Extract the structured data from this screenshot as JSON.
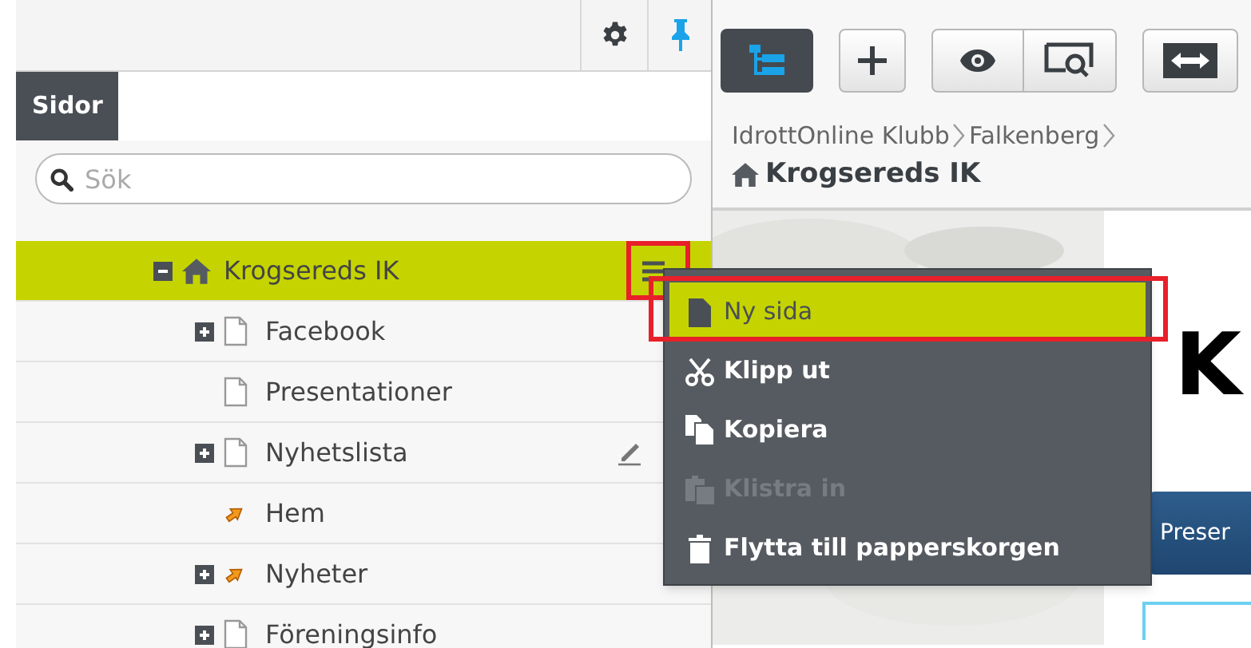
{
  "panel_tab": {
    "label": "Sidor",
    "selected": true
  },
  "search": {
    "placeholder": "Sök"
  },
  "tree": [
    {
      "label": "Krogsereds IK",
      "kind": "home",
      "has_children": true,
      "expanded": true,
      "selected": true,
      "annotated": true,
      "children": [
        {
          "label": "Facebook",
          "kind": "page",
          "has_children": true,
          "expanded": false,
          "selected": false,
          "annotated": false
        },
        {
          "label": "Presentationer",
          "kind": "page",
          "has_children": false,
          "expanded": false,
          "selected": false,
          "annotated": false
        },
        {
          "label": "Nyhetslista",
          "kind": "page",
          "has_children": true,
          "expanded": false,
          "selected": false,
          "annotated": false
        },
        {
          "label": "Hem",
          "kind": "shortcut",
          "has_children": false,
          "expanded": false,
          "selected": false,
          "annotated": false
        },
        {
          "label": "Nyheter",
          "kind": "shortcut",
          "has_children": true,
          "expanded": false,
          "selected": false,
          "annotated": false
        },
        {
          "label": "Föreningsinfo",
          "kind": "page",
          "has_children": true,
          "expanded": false,
          "selected": false,
          "annotated": false
        }
      ]
    }
  ],
  "context_menu": [
    {
      "label": "Ny sida",
      "kind": "page",
      "selected": true,
      "disabled": false,
      "annotated": true
    },
    {
      "label": "Klipp ut",
      "kind": "scissors",
      "selected": false,
      "disabled": false,
      "annotated": false
    },
    {
      "label": "Kopiera",
      "kind": "copy",
      "selected": false,
      "disabled": false,
      "annotated": false
    },
    {
      "label": "Klistra in",
      "kind": "paste",
      "selected": false,
      "disabled": true,
      "annotated": false
    },
    {
      "label": "Flytta till papperskorgen",
      "kind": "trash",
      "selected": false,
      "disabled": false,
      "annotated": false
    }
  ],
  "toolbar": [
    {
      "kind": "tree",
      "selected": true
    },
    {
      "kind": "add",
      "selected": false
    },
    {
      "kind": "view",
      "selected": false
    },
    {
      "kind": "preview",
      "selected": false
    },
    {
      "kind": "resize",
      "selected": false
    }
  ],
  "breadcrumb": [
    {
      "label": "IdrottOnline Klubb"
    },
    {
      "label": "Falkenberg"
    }
  ],
  "page_title": "Krogsereds IK",
  "preview": {
    "heading": "K",
    "button": "Preser"
  }
}
